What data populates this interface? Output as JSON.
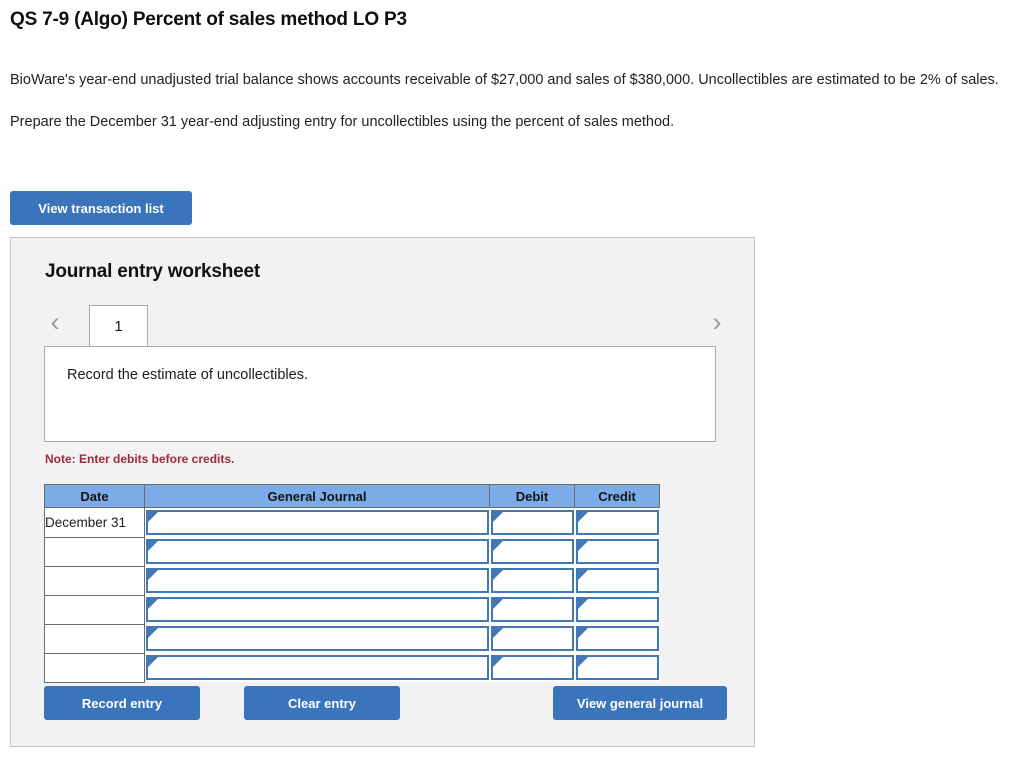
{
  "question": {
    "title": "QS 7-9 (Algo) Percent of sales method LO P3",
    "paragraphs": [
      "BioWare's year-end unadjusted trial balance shows accounts receivable of $27,000 and sales of $380,000. Uncollectibles are estimated to be 2% of sales.",
      "Prepare the December 31 year-end adjusting entry for uncollectibles using the percent of sales method."
    ]
  },
  "toolbar": {
    "view_transaction_list_label": "View transaction list"
  },
  "worksheet": {
    "title": "Journal entry worksheet",
    "tabs": [
      {
        "label": "1",
        "active": true
      }
    ],
    "nav": {
      "prev_icon": "chevron-left-icon",
      "next_icon": "chevron-right-icon",
      "prev_glyph": "‹",
      "next_glyph": "›"
    },
    "instruction": "Record the estimate of uncollectibles.",
    "note": "Note: Enter debits before credits.",
    "table": {
      "columns": [
        "Date",
        "General Journal",
        "Debit",
        "Credit"
      ],
      "rows": [
        {
          "date": "December 31",
          "general_journal": "",
          "debit": "",
          "credit": ""
        },
        {
          "date": "",
          "general_journal": "",
          "debit": "",
          "credit": ""
        },
        {
          "date": "",
          "general_journal": "",
          "debit": "",
          "credit": ""
        },
        {
          "date": "",
          "general_journal": "",
          "debit": "",
          "credit": ""
        },
        {
          "date": "",
          "general_journal": "",
          "debit": "",
          "credit": ""
        },
        {
          "date": "",
          "general_journal": "",
          "debit": "",
          "credit": ""
        }
      ]
    },
    "actions": {
      "record_entry_label": "Record entry",
      "clear_entry_label": "Clear entry",
      "view_general_journal_label": "View general journal"
    }
  },
  "colors": {
    "button_blue": "#3a74ba",
    "table_header_blue": "#7bace8",
    "input_border_blue": "#4278b6",
    "note_red": "#9e2a3a",
    "panel_bg": "#f2f2f2",
    "panel_border": "#c4c4c4"
  }
}
